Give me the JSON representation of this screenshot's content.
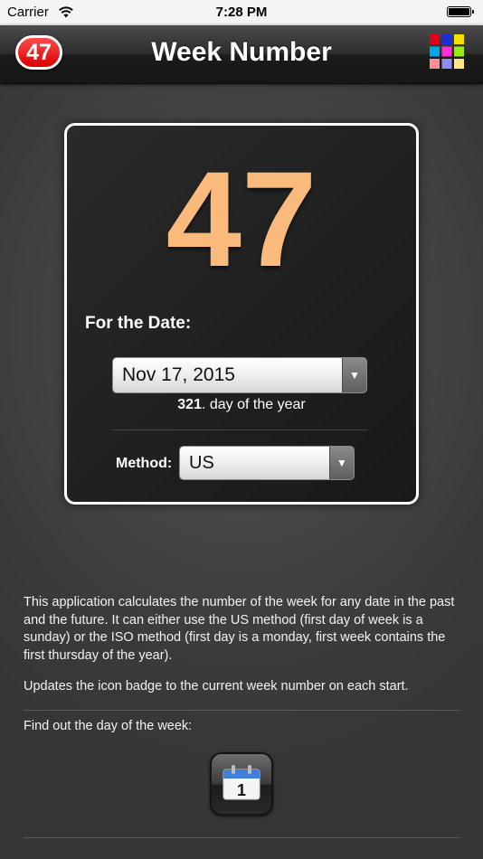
{
  "status_bar": {
    "carrier": "Carrier",
    "time": "7:28 PM"
  },
  "nav": {
    "badge": "47",
    "title": "Week Number",
    "grid_colors": [
      "#e0001b",
      "#1b2fd8",
      "#f8e000",
      "#00a6e8",
      "#ff2fd6",
      "#9be81a",
      "#ff8c96",
      "#8f8cf0",
      "#ffe48a"
    ]
  },
  "card": {
    "week_number": "47",
    "date_label": "For the Date:",
    "date_value": "Nov 17, 2015",
    "day_of_year_num": "321",
    "day_of_year_suffix": ". day of the year",
    "method_label": "Method:",
    "method_value": "US",
    "accent_color": "#f9ba7c"
  },
  "info": {
    "description": "This application calculates the number of the week for any date in the past and the future. It can either use the US method (first day of week is a sunday) or the ISO method (first day is a monday, first week contains the first thursday of the year).",
    "badge_note": "Updates the icon badge to the current week number on each start.",
    "find_label": "Find out the day of the week:",
    "calendar_day": "1"
  }
}
